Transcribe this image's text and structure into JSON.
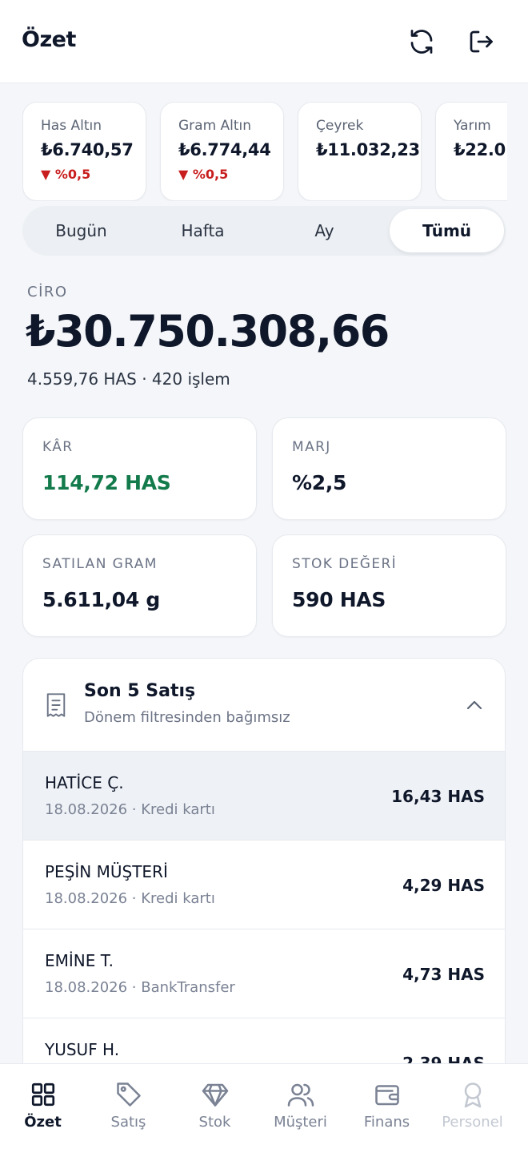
{
  "header": {
    "title": "Özet",
    "refresh_icon": "refresh-icon",
    "logout_icon": "logout-icon"
  },
  "ticker": [
    {
      "name": "Has Altın",
      "price": "₺6.740,57",
      "change": "▼ %0,5"
    },
    {
      "name": "Gram Altın",
      "price": "₺6.774,44",
      "change": "▼ %0,5"
    },
    {
      "name": "Çeyrek",
      "price": "₺11.032,23",
      "change": ""
    },
    {
      "name": "Yarım",
      "price": "₺22.0",
      "change": ""
    }
  ],
  "period_filter": {
    "options": [
      "Bugün",
      "Hafta",
      "Ay",
      "Tümü"
    ],
    "selected": "Tümü"
  },
  "ciro": {
    "label": "CİRO",
    "value": "₺30.750.308,66",
    "sub": "4.559,76 HAS · 420 işlem"
  },
  "stats": [
    {
      "label": "KÂR",
      "value": "114,72 HAS"
    },
    {
      "label": "MARJ",
      "value": "%2,5"
    },
    {
      "label": "SATILAN GRAM",
      "value": "5.611,04 g"
    },
    {
      "label": "STOK DEĞERİ",
      "value": "590 HAS"
    }
  ],
  "recent_sales": {
    "title": "Son 5 Satış",
    "subtitle": "Dönem filtresinden bağımsız",
    "rows": [
      {
        "name": "HATİCE Ç.",
        "meta": "18.08.2026 · Kredi kartı",
        "amount": "16,43 HAS"
      },
      {
        "name": "PEŞİN MÜŞTERİ",
        "meta": "18.08.2026 · Kredi kartı",
        "amount": "4,29 HAS"
      },
      {
        "name": "EMİNE T.",
        "meta": "18.08.2026 · BankTransfer",
        "amount": "4,73 HAS"
      },
      {
        "name": "YUSUF H.",
        "meta": "",
        "amount": "2,39 HAS"
      }
    ]
  },
  "tabbar": {
    "tabs": [
      {
        "label": "Özet",
        "icon": "grid-icon"
      },
      {
        "label": "Satış",
        "icon": "tag-icon"
      },
      {
        "label": "Stok",
        "icon": "diamond-icon"
      },
      {
        "label": "Müşteri",
        "icon": "users-icon"
      },
      {
        "label": "Finans",
        "icon": "wallet-icon"
      },
      {
        "label": "Personel",
        "icon": "award-icon"
      }
    ],
    "active": "Özet",
    "disabled": "Personel"
  },
  "colors": {
    "text_primary": "#0f172a",
    "text_muted": "#6b7385",
    "negative": "#c81e1e",
    "positive": "#127a4b",
    "background": "#f4f6f9"
  }
}
